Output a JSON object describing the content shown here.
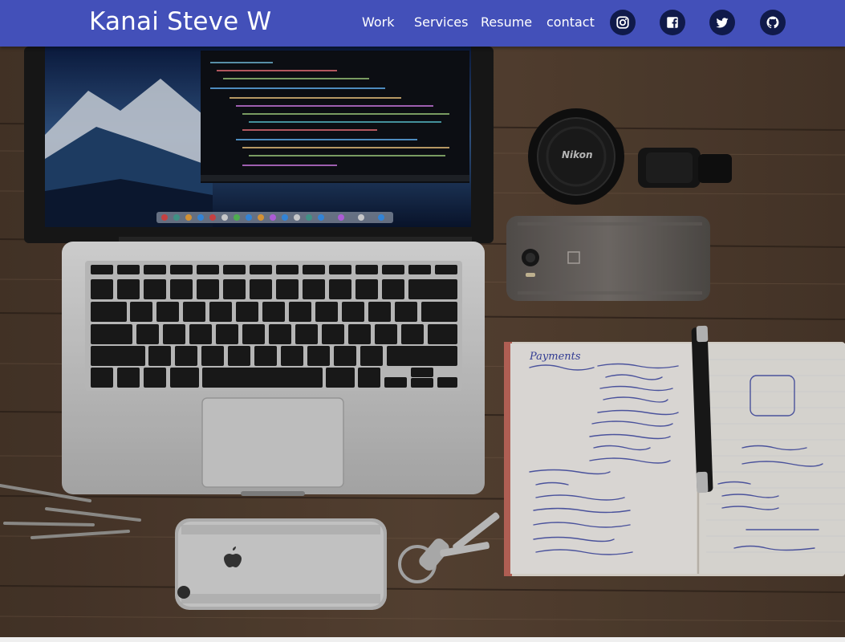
{
  "navbar": {
    "brand": "Kanai Steve W",
    "links": [
      {
        "label": "Work"
      },
      {
        "label": "Services"
      },
      {
        "label": "Resume"
      },
      {
        "label": "contact"
      }
    ],
    "social": [
      {
        "icon": "instagram-icon"
      },
      {
        "icon": "facebook-icon"
      },
      {
        "icon": "twitter-icon"
      },
      {
        "icon": "github-icon"
      }
    ]
  },
  "hero": {
    "nikon_text": "Nikon",
    "notebook_heading": "Payments"
  },
  "colors": {
    "navbar_bg": "#4350b9",
    "social_bg": "#101a4a",
    "desk": "#5a4535"
  }
}
